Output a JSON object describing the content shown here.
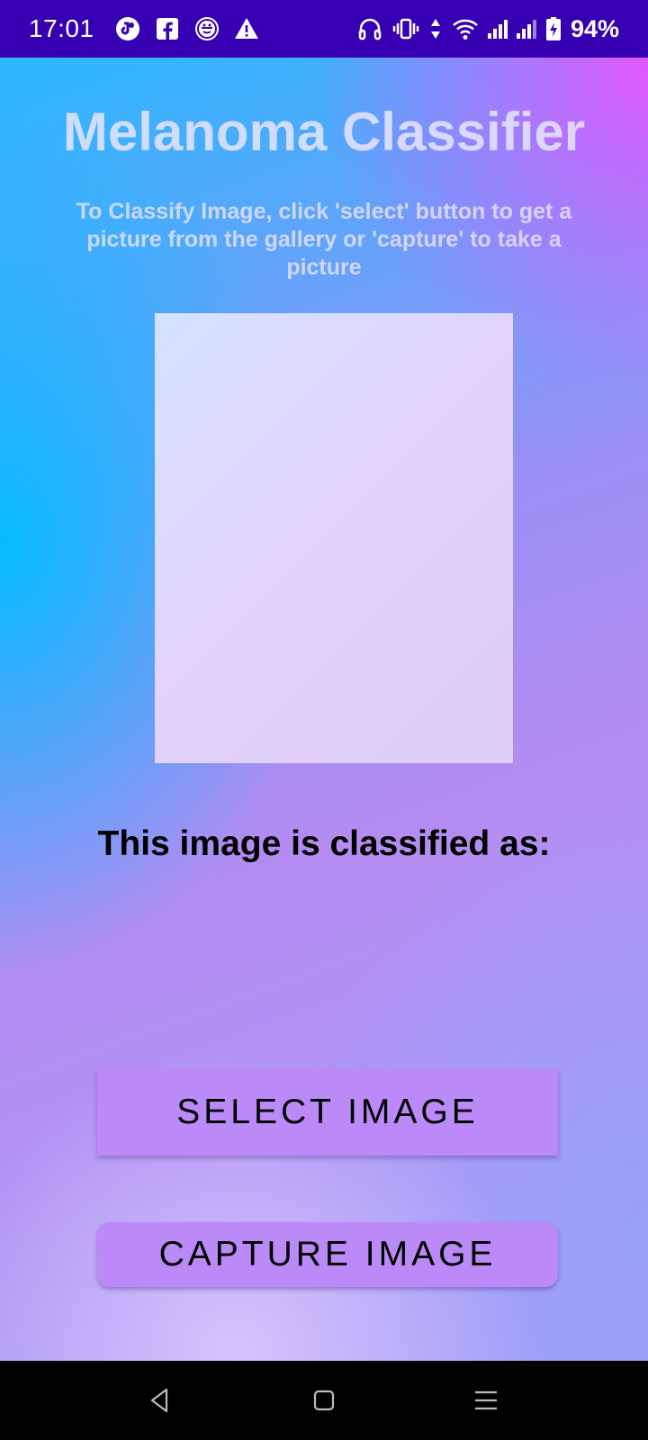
{
  "status_bar": {
    "time": "17:01",
    "left_icons": [
      "tiktok-icon",
      "facebook-icon",
      "spy-icon",
      "warning-icon"
    ],
    "right_icons": [
      "headphones-icon",
      "vibrate-icon",
      "data-arrows-icon",
      "wifi-icon",
      "signal-1-icon",
      "signal-2-icon",
      "battery-charging-icon"
    ],
    "battery_percent": "94%"
  },
  "app": {
    "title": "Melanoma Classifier",
    "instructions": "To Classify Image, click 'select' button to get a picture from the gallery or 'capture' to take a picture",
    "result_label": "This image is classified as:",
    "result_value": "",
    "select_button_label": "SELECT IMAGE",
    "capture_button_label": "CAPTURE IMAGE",
    "colors": {
      "button": "#bc8af8",
      "status_bar": "#3700b3"
    }
  },
  "nav_bar": {
    "icons": [
      "back-icon",
      "home-icon",
      "recents-icon"
    ]
  }
}
